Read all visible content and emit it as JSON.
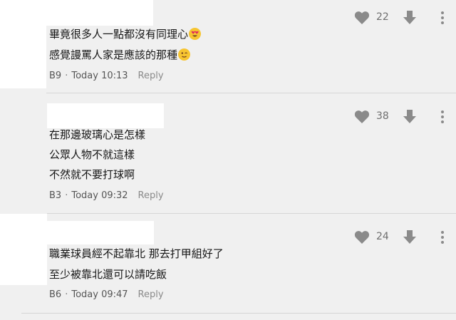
{
  "comments": [
    {
      "lines": [
        {
          "text": "畢竟很多人一點都沒有同理心",
          "emoji": "heart-eyes-emoji"
        },
        {
          "text": "感覺謾罵人家是應該的那種",
          "emoji": "wink-emoji"
        }
      ],
      "floor": "B9",
      "time": "Today 10:13",
      "reply": "Reply",
      "likes": "22"
    },
    {
      "lines": [
        {
          "text": "在那邊玻璃心是怎樣"
        },
        {
          "text": "公眾人物不就這樣"
        },
        {
          "text": "不然就不要打球啊"
        }
      ],
      "floor": "B3",
      "time": "Today 09:32",
      "reply": "Reply",
      "likes": "38"
    },
    {
      "lines": [
        {
          "text": "職業球員經不起靠北 那去打甲組好了"
        },
        {
          "text": "至少被靠北還可以請吃飯"
        }
      ],
      "floor": "B6",
      "time": "Today 09:47",
      "reply": "Reply",
      "likes": "24"
    }
  ],
  "separator": "·",
  "colors": {
    "background": "#f0f0f0",
    "icon": "#8a8a8a",
    "cover": "#ffffff"
  },
  "icons": {
    "like": "heart-icon",
    "dislike": "arrow-down-icon",
    "menu": "more-vertical-icon"
  }
}
